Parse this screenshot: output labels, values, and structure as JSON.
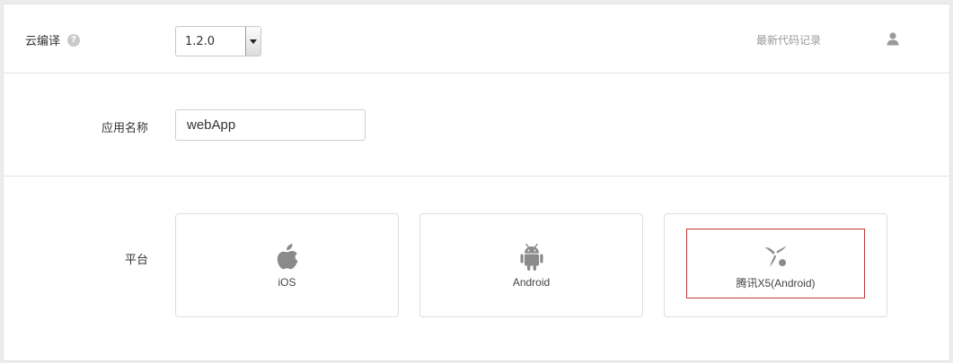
{
  "header": {
    "title": "云编译",
    "help_icon": "help-circle-icon",
    "version": "1.2.0",
    "latest_link": "最新代码记录",
    "user_icon": "user-icon"
  },
  "app": {
    "label": "应用名称",
    "value": "webApp"
  },
  "platform": {
    "label": "平台",
    "options": [
      {
        "label": "iOS",
        "icon": "apple-icon",
        "selected": false
      },
      {
        "label": "Android",
        "icon": "android-icon",
        "selected": false
      },
      {
        "label": "腾讯X5(Android)",
        "icon": "x5-icon",
        "selected": true
      }
    ]
  },
  "colors": {
    "selected_border": "#c0393b",
    "icon_gray": "#8a8a8a",
    "link_gray": "#999999"
  }
}
